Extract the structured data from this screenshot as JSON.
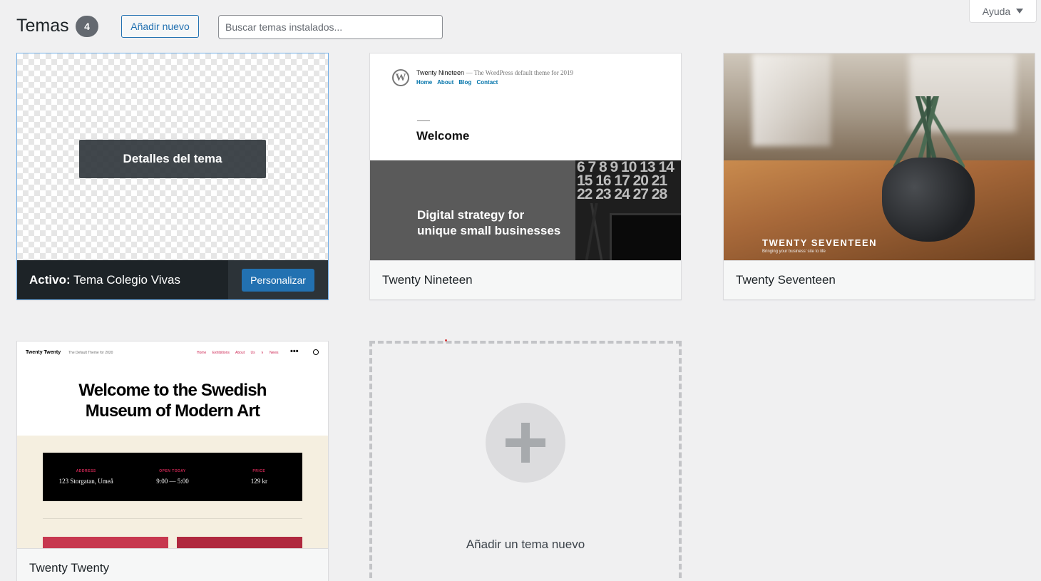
{
  "header": {
    "title": "Temas",
    "count": "4",
    "add_new_label": "Añadir nuevo",
    "search_placeholder": "Buscar temas instalados...",
    "help_label": "Ayuda"
  },
  "active_theme": {
    "details_label": "Detalles del tema",
    "active_prefix": "Activo:",
    "name": "Tema Colegio Vivas",
    "customize_label": "Personalizar"
  },
  "themes": [
    {
      "name": "Twenty Nineteen",
      "preview": {
        "site_title": "Twenty Nineteen",
        "site_desc": "— The WordPress default theme for 2019",
        "nav": "Home About Blog Contact",
        "heading": "Welcome",
        "tagline_1": "Digital strategy for",
        "tagline_2": "unique small businesses",
        "calendar": "6 7 8 9 10 13 14 15 16 17 20 21 22 23 24 27 28"
      }
    },
    {
      "name": "Twenty Seventeen",
      "preview": {
        "title": "TWENTY SEVENTEEN",
        "subtitle": "Bringing your business' site to life"
      }
    },
    {
      "name": "Twenty Twenty",
      "preview": {
        "site_title": "Twenty Twenty",
        "site_desc": "The Default Theme for 2020",
        "menu": "Home Exhibitions About Us ∨ News",
        "headline_1": "Welcome to the Swedish",
        "headline_2": "Museum of Modern Art",
        "info": [
          {
            "key": "ADDRESS",
            "value": "123 Storgatan, Umeå"
          },
          {
            "key": "OPEN TODAY",
            "value": "9:00 — 5:00"
          },
          {
            "key": "PRICE",
            "value": "129 kr"
          }
        ]
      }
    }
  ],
  "add_theme": {
    "label": "Añadir un tema nuevo"
  },
  "colors": {
    "accent": "#2271b1",
    "background": "#f0f0f1",
    "active_bar": "#1d2327"
  }
}
